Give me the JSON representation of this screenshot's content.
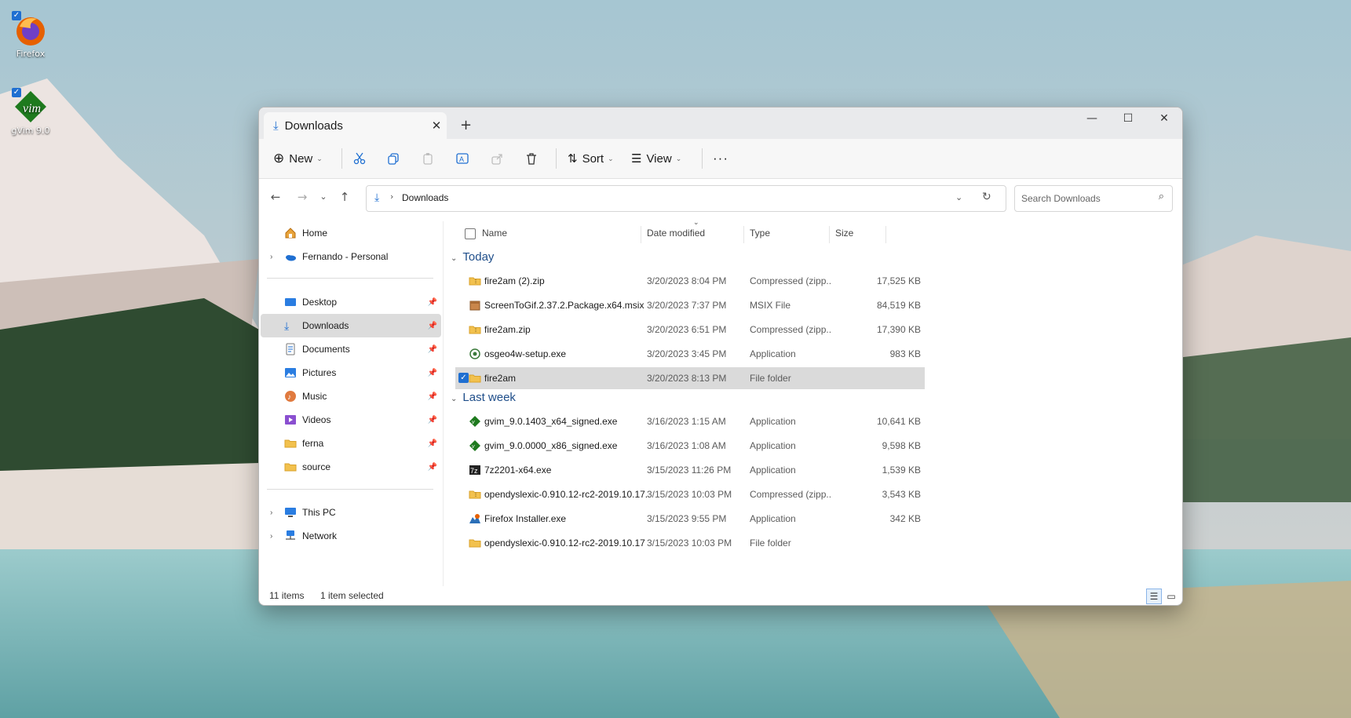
{
  "desktop": {
    "icons": [
      {
        "label": "Firefox",
        "icon": "firefox-icon"
      },
      {
        "label": "gVim 9.0",
        "icon": "gvim-icon"
      }
    ]
  },
  "window": {
    "tab_title": "Downloads",
    "toolbar": {
      "new_label": "New",
      "sort_label": "Sort",
      "view_label": "View"
    },
    "address": {
      "path": "Downloads",
      "search_placeholder": "Search Downloads"
    },
    "sidebar": {
      "top": [
        {
          "label": "Home",
          "icon": "home-icon"
        },
        {
          "label": "Fernando - Personal",
          "icon": "onedrive-icon"
        }
      ],
      "quick": [
        {
          "label": "Desktop",
          "icon": "desktop-folder-icon"
        },
        {
          "label": "Downloads",
          "icon": "downloads-folder-icon",
          "selected": true
        },
        {
          "label": "Documents",
          "icon": "documents-folder-icon"
        },
        {
          "label": "Pictures",
          "icon": "pictures-folder-icon"
        },
        {
          "label": "Music",
          "icon": "music-folder-icon"
        },
        {
          "label": "Videos",
          "icon": "videos-folder-icon"
        },
        {
          "label": "ferna",
          "icon": "folder-icon"
        },
        {
          "label": "source",
          "icon": "folder-icon"
        }
      ],
      "bottom": [
        {
          "label": "This PC",
          "icon": "this-pc-icon"
        },
        {
          "label": "Network",
          "icon": "network-icon"
        }
      ]
    },
    "columns": {
      "name": "Name",
      "date": "Date modified",
      "type": "Type",
      "size": "Size"
    },
    "groups": [
      {
        "label": "Today",
        "files": [
          {
            "name": "fire2am (2).zip",
            "date": "3/20/2023 8:04 PM",
            "type": "Compressed (zipp...",
            "size": "17,525 KB",
            "icon": "zip-folder-icon"
          },
          {
            "name": "ScreenToGif.2.37.2.Package.x64.msix",
            "date": "3/20/2023 7:37 PM",
            "type": "MSIX File",
            "size": "84,519 KB",
            "icon": "package-icon"
          },
          {
            "name": "fire2am.zip",
            "date": "3/20/2023 6:51 PM",
            "type": "Compressed (zipp...",
            "size": "17,390 KB",
            "icon": "zip-folder-icon"
          },
          {
            "name": "osgeo4w-setup.exe",
            "date": "3/20/2023 3:45 PM",
            "type": "Application",
            "size": "983 KB",
            "icon": "osgeo-icon"
          },
          {
            "name": "fire2am",
            "date": "3/20/2023 8:13 PM",
            "type": "File folder",
            "size": "",
            "icon": "folder-icon",
            "selected": true
          }
        ]
      },
      {
        "label": "Last week",
        "files": [
          {
            "name": "gvim_9.0.1403_x64_signed.exe",
            "date": "3/16/2023 1:15 AM",
            "type": "Application",
            "size": "10,641 KB",
            "icon": "gvim-icon"
          },
          {
            "name": "gvim_9.0.0000_x86_signed.exe",
            "date": "3/16/2023 1:08 AM",
            "type": "Application",
            "size": "9,598 KB",
            "icon": "gvim-icon"
          },
          {
            "name": "7z2201-x64.exe",
            "date": "3/15/2023 11:26 PM",
            "type": "Application",
            "size": "1,539 KB",
            "icon": "7zip-icon"
          },
          {
            "name": "opendyslexic-0.910.12-rc2-2019.10.17....",
            "date": "3/15/2023 10:03 PM",
            "type": "Compressed (zipp...",
            "size": "3,543 KB",
            "icon": "zip-folder-icon"
          },
          {
            "name": "Firefox Installer.exe",
            "date": "3/15/2023 9:55 PM",
            "type": "Application",
            "size": "342 KB",
            "icon": "firefox-installer-icon"
          },
          {
            "name": "opendyslexic-0.910.12-rc2-2019.10.17",
            "date": "3/15/2023 10:03 PM",
            "type": "File folder",
            "size": "",
            "icon": "folder-icon"
          }
        ]
      }
    ],
    "status": {
      "item_count": "11 items",
      "selection": "1 item selected"
    }
  }
}
